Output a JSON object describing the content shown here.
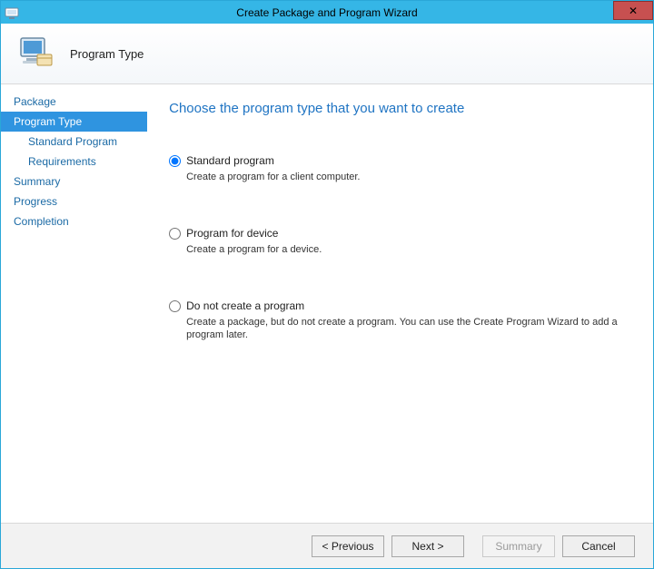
{
  "window": {
    "title": "Create Package and Program Wizard",
    "close_glyph": "✕"
  },
  "banner": {
    "title": "Program Type"
  },
  "sidebar": {
    "items": [
      {
        "label": "Package",
        "sub": false,
        "active": false
      },
      {
        "label": "Program Type",
        "sub": false,
        "active": true
      },
      {
        "label": "Standard Program",
        "sub": true,
        "active": false
      },
      {
        "label": "Requirements",
        "sub": true,
        "active": false
      },
      {
        "label": "Summary",
        "sub": false,
        "active": false
      },
      {
        "label": "Progress",
        "sub": false,
        "active": false
      },
      {
        "label": "Completion",
        "sub": false,
        "active": false
      }
    ]
  },
  "content": {
    "heading": "Choose the program type that you want to create",
    "options": [
      {
        "id": "standard",
        "label": "Standard program",
        "desc": "Create a program for a client computer.",
        "selected": true
      },
      {
        "id": "device",
        "label": "Program for device",
        "desc": "Create a program for a device.",
        "selected": false
      },
      {
        "id": "none",
        "label": "Do not create a program",
        "desc": "Create a package, but do not create a program. You can use the Create Program Wizard to add a program later.",
        "selected": false
      }
    ]
  },
  "footer": {
    "previous": "< Previous",
    "next": "Next >",
    "summary": "Summary",
    "cancel": "Cancel",
    "summary_enabled": false
  }
}
